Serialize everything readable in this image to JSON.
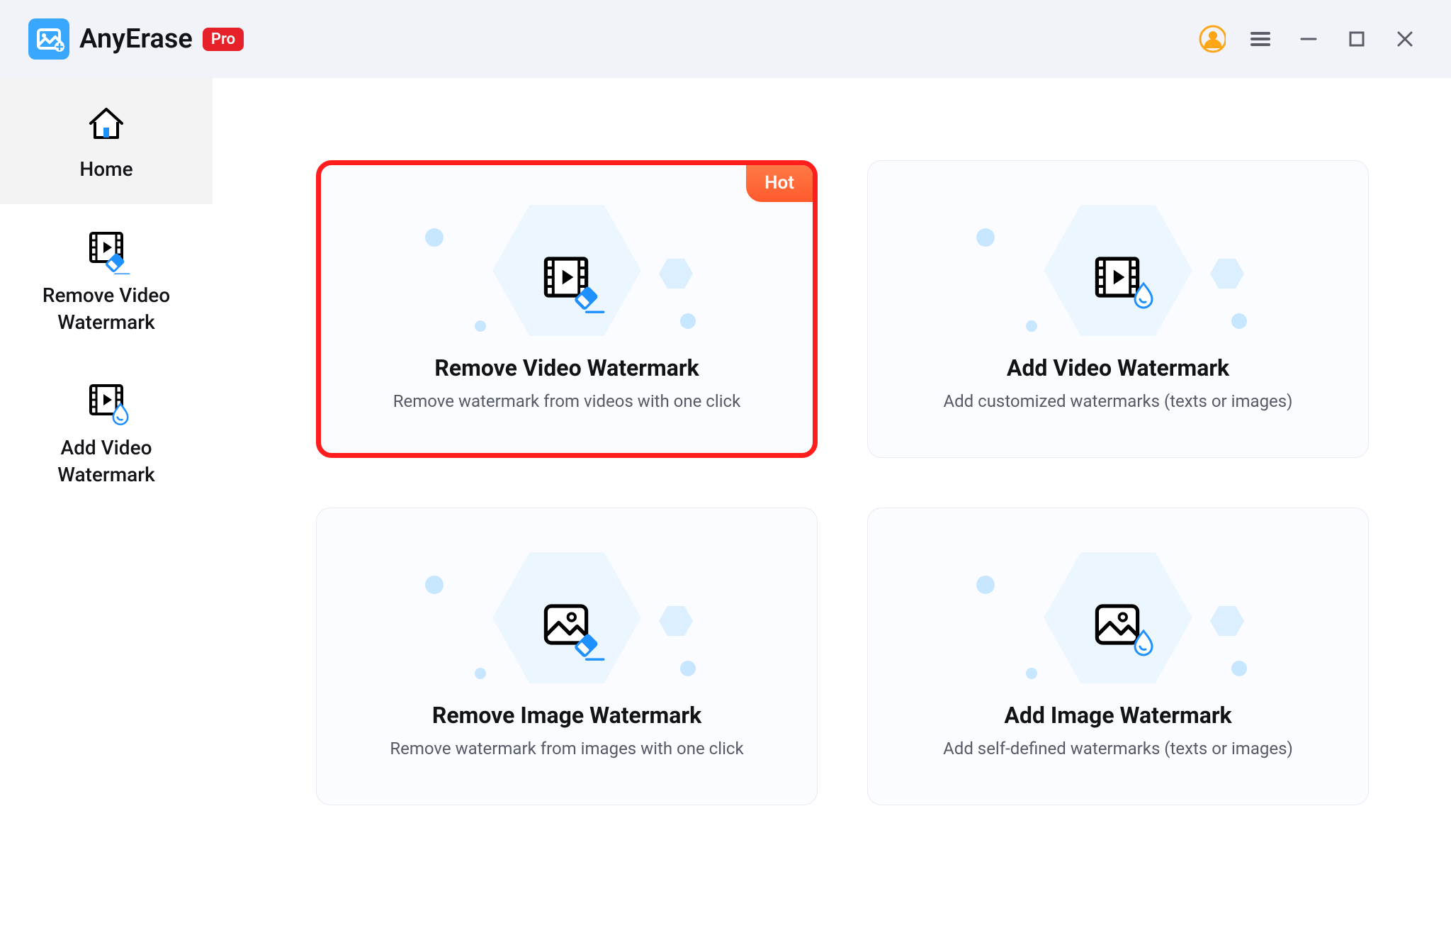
{
  "app": {
    "name": "AnyErase",
    "badge": "Pro"
  },
  "window_controls": {
    "account": "account",
    "menu": "menu",
    "minimize": "minimize",
    "maximize": "maximize",
    "close": "close"
  },
  "sidebar": {
    "items": [
      {
        "label": "Home",
        "icon": "home",
        "selected": true
      },
      {
        "label": "Remove Video\nWatermark",
        "icon": "video-erase",
        "selected": false
      },
      {
        "label": "Add Video\nWatermark",
        "icon": "video-drop",
        "selected": false
      }
    ]
  },
  "cards": [
    {
      "title": "Remove Video Watermark",
      "desc": "Remove watermark from videos with one click",
      "icon": "video-erase",
      "badge": "Hot",
      "highlight": true
    },
    {
      "title": "Add Video Watermark",
      "desc": "Add customized watermarks (texts or images)",
      "icon": "video-drop",
      "badge": null,
      "highlight": false
    },
    {
      "title": "Remove Image Watermark",
      "desc": "Remove watermark from images with one click",
      "icon": "image-erase",
      "badge": null,
      "highlight": false
    },
    {
      "title": "Add Image Watermark",
      "desc": "Add self-defined watermarks  (texts or images)",
      "icon": "image-drop",
      "badge": null,
      "highlight": false
    }
  ]
}
